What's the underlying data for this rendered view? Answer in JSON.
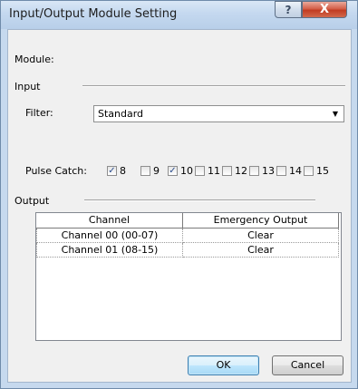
{
  "window": {
    "title": "Input/Output Module Setting",
    "help_glyph": "?",
    "close_glyph": "X"
  },
  "module": {
    "label": "Module:"
  },
  "input": {
    "label": "Input",
    "filter_label": "Filter:",
    "filter_value": "Standard",
    "filter_arrow": "▼",
    "pulse_catch_label": "Pulse Catch:",
    "pulse_catch": [
      {
        "label": "8",
        "checked": true,
        "mark": "✓"
      },
      {
        "label": "9",
        "checked": false,
        "mark": ""
      },
      {
        "label": "10",
        "checked": true,
        "mark": "✓"
      },
      {
        "label": "11",
        "checked": false,
        "mark": ""
      },
      {
        "label": "12",
        "checked": false,
        "mark": ""
      },
      {
        "label": "13",
        "checked": false,
        "mark": ""
      },
      {
        "label": "14",
        "checked": false,
        "mark": ""
      },
      {
        "label": "15",
        "checked": false,
        "mark": ""
      }
    ]
  },
  "output": {
    "label": "Output",
    "columns": [
      "Channel",
      "Emergency Output"
    ],
    "rows": [
      [
        "Channel 00 (00-07)",
        "Clear"
      ],
      [
        "Channel 01 (08-15)",
        "Clear"
      ]
    ]
  },
  "buttons": {
    "ok": "OK",
    "cancel": "Cancel"
  }
}
